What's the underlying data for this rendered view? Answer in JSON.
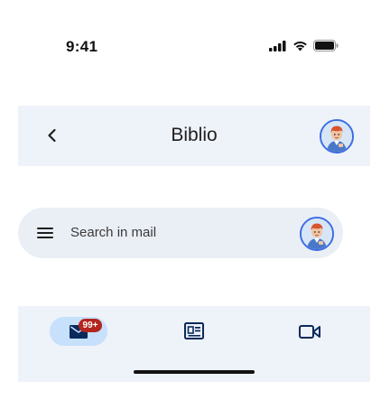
{
  "status_bar": {
    "time": "9:41",
    "icons": [
      "cellular-signal-icon",
      "wifi-icon",
      "battery-icon"
    ]
  },
  "app_bar": {
    "title": "Biblio",
    "back_icon": "chevron-left-icon",
    "avatar": "account-avatar"
  },
  "search_bar": {
    "menu_icon": "hamburger-menu-icon",
    "placeholder": "Search in mail",
    "avatar": "account-avatar"
  },
  "bottom_nav": {
    "items": [
      {
        "icon": "mail-icon",
        "badge": "99+",
        "selected": true
      },
      {
        "icon": "news-icon",
        "selected": false
      },
      {
        "icon": "video-icon",
        "selected": false
      }
    ]
  },
  "colors": {
    "bar_background": "#eef2f9",
    "search_background": "#eaeef5",
    "selected_pill": "#c7e0fb",
    "badge": "#b3261e",
    "avatar_ring": "#3b6de3",
    "mail_icon": "#0b2a5b"
  }
}
